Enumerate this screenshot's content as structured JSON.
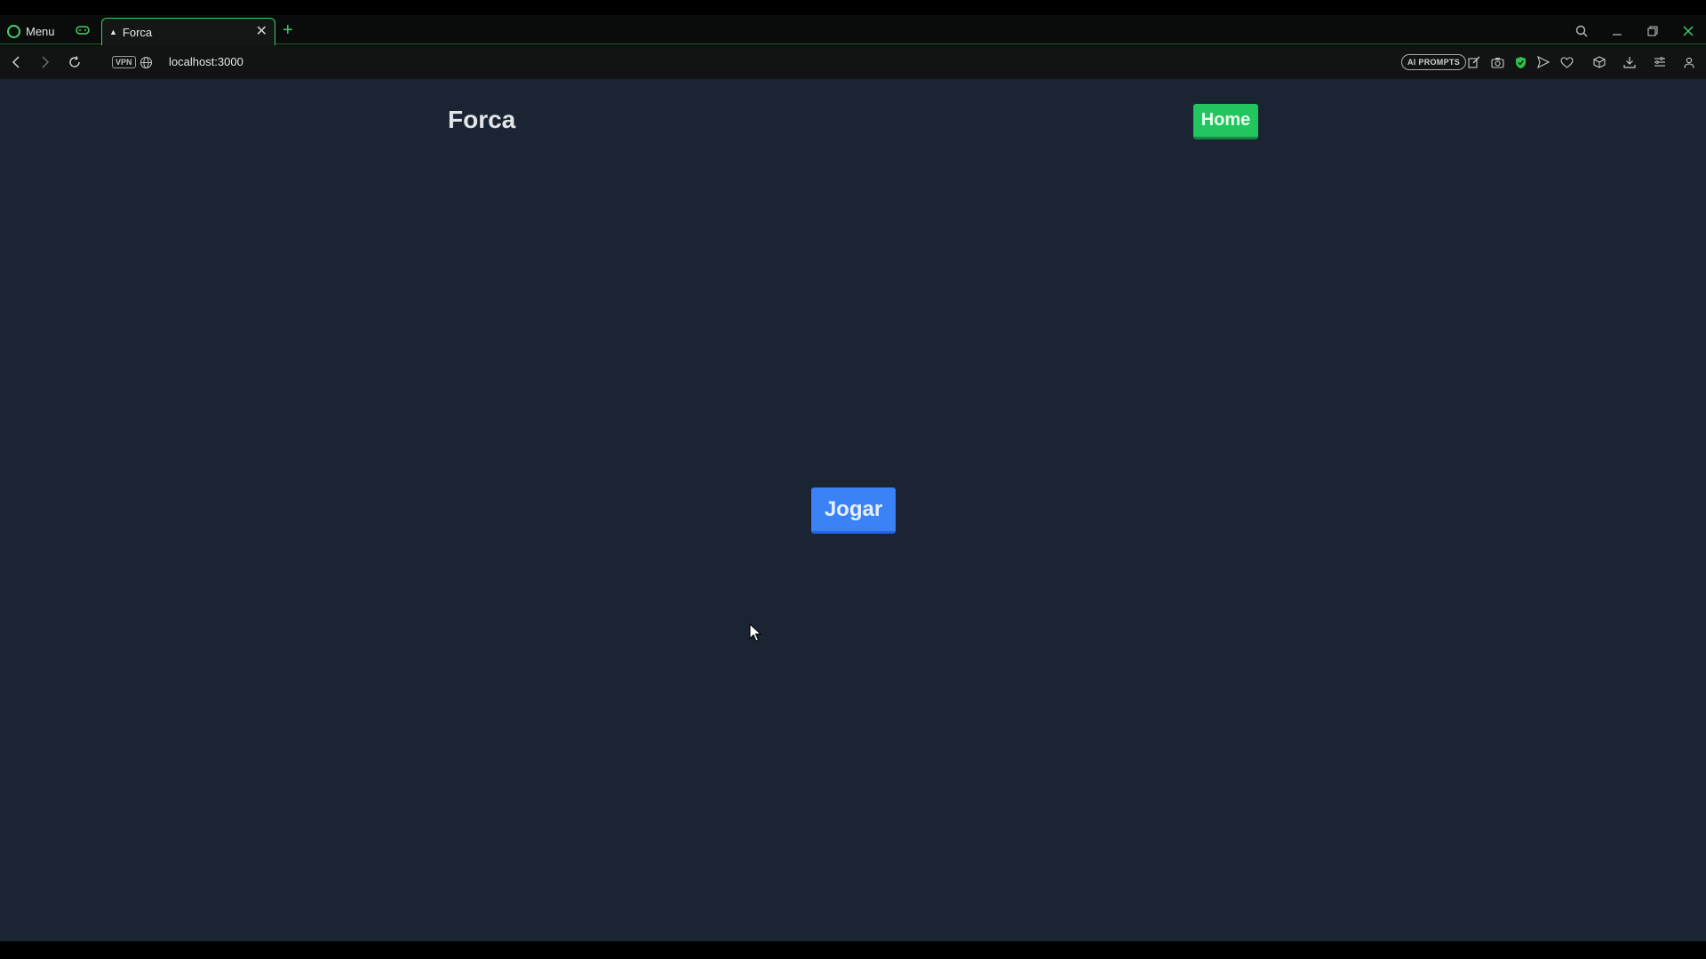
{
  "browser": {
    "menu_label": "Menu",
    "tab": {
      "title": "Forca",
      "close_glyph": "✕",
      "favicon_glyph": "▲"
    },
    "new_tab_glyph": "+",
    "url": "localhost:3000",
    "vpn_label": "VPN",
    "ai_prompts_label": "AI PROMPTS",
    "accent_color": "#45d06a"
  },
  "page": {
    "title": "Forca",
    "home_button": "Home",
    "play_button": "Jogar",
    "background_color": "#1b2432",
    "home_button_color": "#22c55e",
    "play_button_color": "#3b82f6"
  }
}
